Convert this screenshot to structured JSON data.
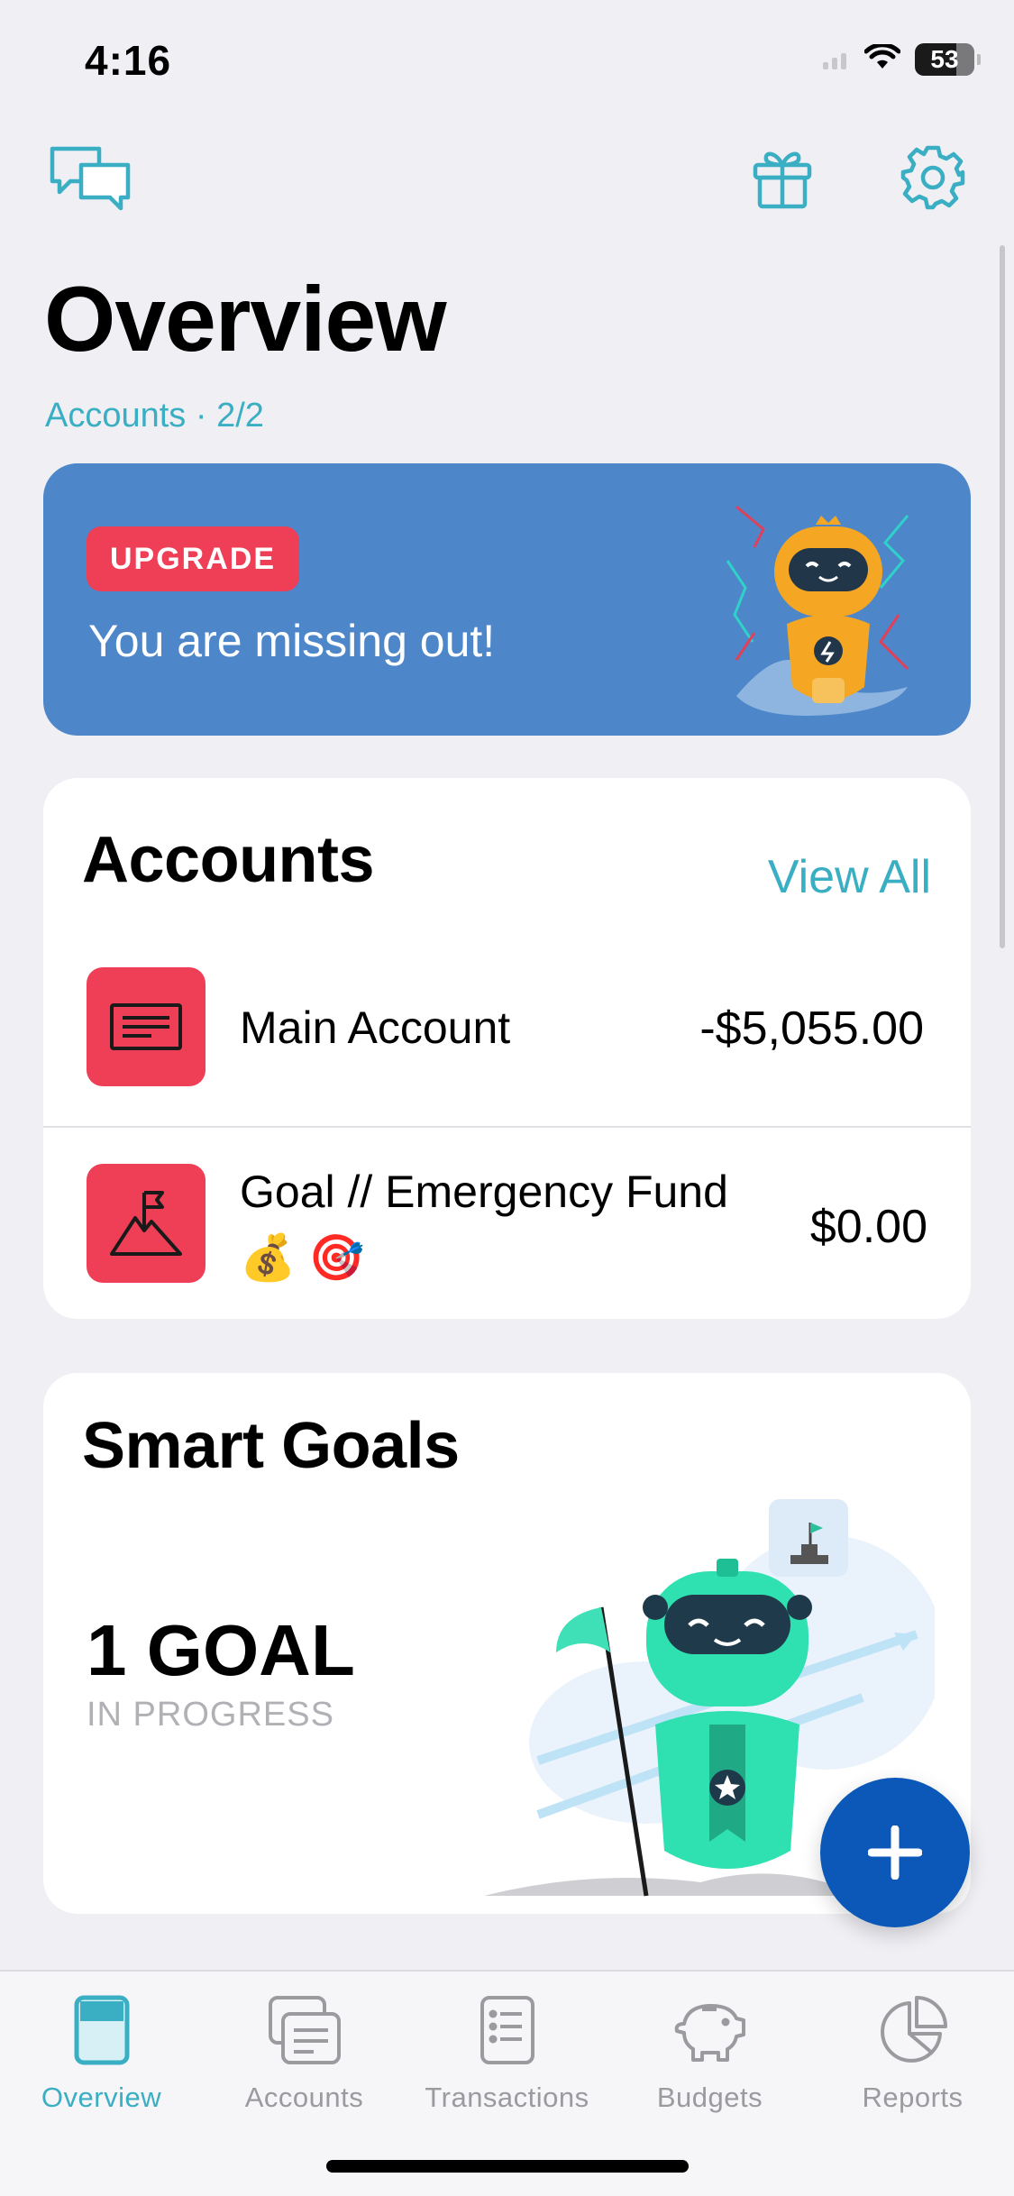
{
  "status_bar": {
    "time": "4:16",
    "battery": "53",
    "battery_level_percent": 53
  },
  "header": {
    "chat_icon": "chat-bubbles-icon",
    "gift_icon": "gift-icon",
    "settings_icon": "gear-icon",
    "title": "Overview",
    "accounts_count": "Accounts · 2/2"
  },
  "banner": {
    "badge": "UPGRADE",
    "message": "You are missing out!",
    "background": "#4d87c9",
    "badge_color": "#ef3f57"
  },
  "accounts": {
    "title": "Accounts",
    "view_all": "View All",
    "items": [
      {
        "name": "Main Account",
        "amount": "-$5,055.00",
        "icon": "check-icon",
        "emoji": ""
      },
      {
        "name": "Goal // Emergency Fund",
        "amount": "$0.00",
        "icon": "mountain-flag-icon",
        "emoji": "💰 🎯"
      }
    ]
  },
  "goals": {
    "title": "Smart Goals",
    "count": "1 GOAL",
    "status": "IN PROGRESS"
  },
  "fab": {
    "icon": "plus-icon",
    "color": "#0b58b8"
  },
  "tabs": [
    {
      "label": "Overview",
      "icon": "overview-icon",
      "active": true
    },
    {
      "label": "Accounts",
      "icon": "accounts-icon",
      "active": false
    },
    {
      "label": "Transactions",
      "icon": "transactions-icon",
      "active": false
    },
    {
      "label": "Budgets",
      "icon": "piggy-bank-icon",
      "active": false
    },
    {
      "label": "Reports",
      "icon": "pie-chart-icon",
      "active": false
    }
  ],
  "colors": {
    "accent": "#3aaec3",
    "background": "#efeff4",
    "negative_red": "#ef3f57"
  }
}
